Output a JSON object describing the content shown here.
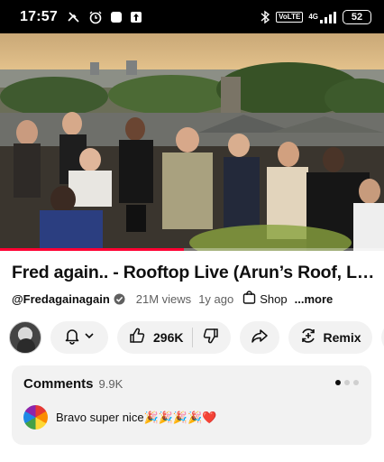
{
  "status_bar": {
    "time": "17:57",
    "volte_label": "Vo\nLTE",
    "net_label": "4G",
    "battery": "52"
  },
  "video": {
    "progress_percent": 48
  },
  "title": "Fred again.. - Rooftop Live (Arun’s Roof, London)",
  "meta": {
    "channel": "@Fredagainagain",
    "views": "21M views",
    "age": "1y ago",
    "shop": "Shop",
    "more": "...more"
  },
  "actions": {
    "likes": "296K",
    "remix": "Remix"
  },
  "comments": {
    "title": "Comments",
    "count": "9.9K",
    "top_comment": "Bravo super nice🎉🎉🎉🎉❤️"
  },
  "icons": {
    "bell": "bell-icon",
    "like": "thumbs-up-icon",
    "dislike": "thumbs-down-icon",
    "share": "share-icon",
    "remix": "remix-icon",
    "download": "download-icon"
  },
  "colors": {
    "progress": "#ff0033",
    "pill_bg": "#f2f2f2",
    "text": "#0f0f0f",
    "secondary_text": "#606060"
  }
}
